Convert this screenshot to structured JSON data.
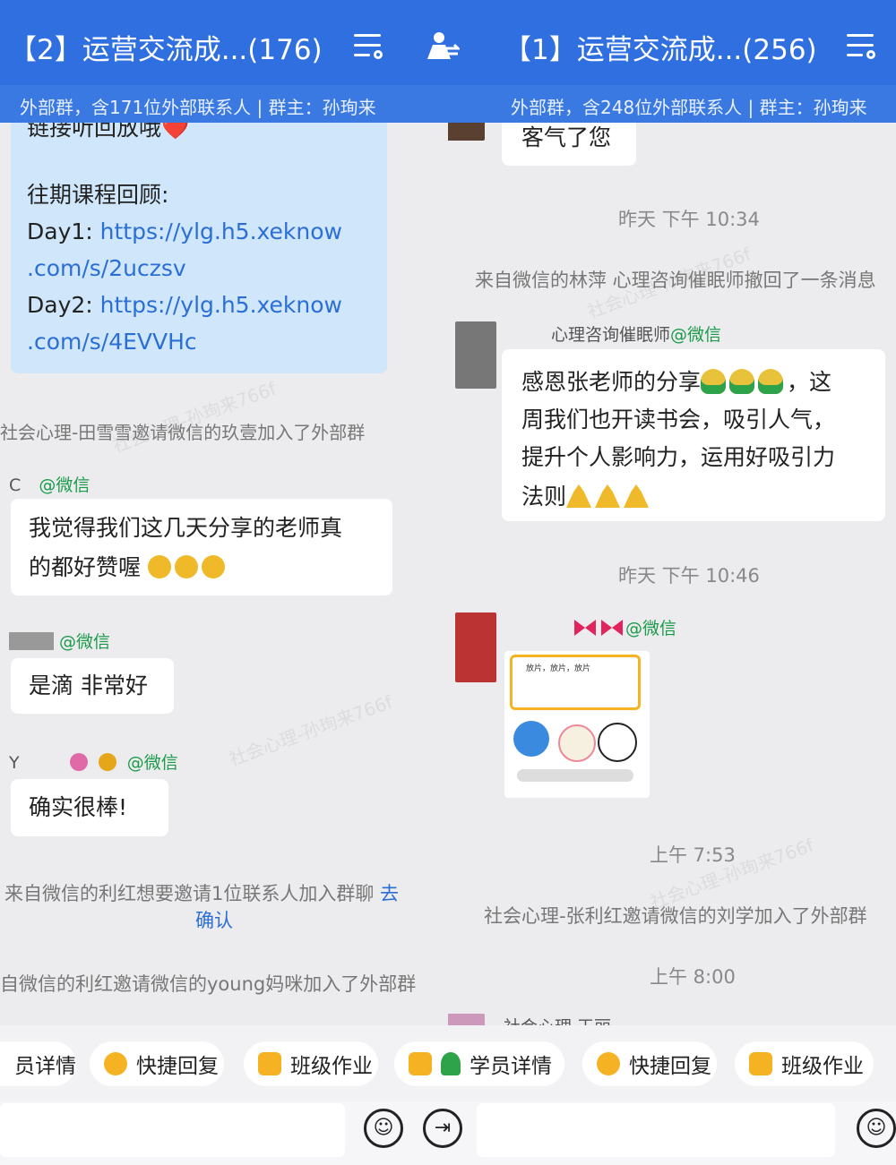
{
  "left": {
    "title": "【2】运营交流成...(176)",
    "subtitle": "外部群，含171位外部联系人 | 群主：孙珣来",
    "messages": {
      "link_bubble": {
        "line1": "链接听回放哦❤️",
        "review_label": "往期课程回顾:",
        "day1_label": "Day1:",
        "day1_url_a": "https://ylg.h5.xeknow",
        "day1_url_b": ".com/s/2uczsv",
        "day2_label": "Day2:",
        "day2_url_a": "https://ylg.h5.xeknow",
        "day2_url_b": ".com/s/4EVVHc"
      },
      "sys1": "社会心理-田雪雪邀请微信的玖壹加入了外部群",
      "sender1_prefix": "C",
      "sender1_tag": "@微信",
      "bubble1_a": "我觉得我们这几天分享的老师真",
      "bubble1_b": "的都好赞喔",
      "sender2_tag": "@微信",
      "bubble2": "是滴 非常好",
      "sender3_prefix": "Y",
      "sender3_tag": "@微信",
      "bubble3": "确实很棒!",
      "sys2_a": "来自微信的利红想要邀请1位联系人加入群聊",
      "sys2_link_a": "去",
      "sys2_link_b": "确认",
      "sys3": "自微信的利红邀请微信的young妈咪加入了外部群"
    }
  },
  "right": {
    "title": "【1】运营交流成...(256)",
    "subtitle": "外部群，含248位外部联系人 | 群主：孙珣来",
    "messages": {
      "bubble0": "客气了您",
      "time1": "昨天  下午 10:34",
      "sys1": "来自微信的林萍 心理咨询催眠师撤回了一条消息",
      "sender1_name": "心理咨询催眠师",
      "sender1_tag": "@微信",
      "bubble1_a": "感恩张老师的分享",
      "bubble1_b": "，这",
      "bubble1_c": "周我们也开读书会，吸引人气，",
      "bubble1_d": "提升个人影响力，运用好吸引力",
      "bubble1_e": "法则",
      "time2": "昨天  下午 10:46",
      "sender2_tag": "@微信",
      "sticker_text": "放片，放片，放片",
      "time3": "上午 7:53",
      "sys2": "社会心理-张利红邀请微信的刘学加入了外部群",
      "time4": "上午 8:00",
      "sender3_partial": "社会心理  王丽"
    }
  },
  "toolbar": {
    "items": [
      "员详情",
      "快捷回复",
      "班级作业",
      "学员详情",
      "快捷回复",
      "班级作业"
    ]
  },
  "icons": {
    "menu": "list-settings-icon",
    "transfer": "person-transfer-icon",
    "emoji": "smiley-face-icon",
    "voice": "voice-input-icon"
  },
  "watermark": "社会心理-孙珣来766f",
  "colors": {
    "header": "#2f6fe0",
    "subheader": "#3a78e2",
    "link": "#2b6fd6",
    "wechat_tag": "#1a9b4a",
    "my_bubble": "#cfe6fb"
  }
}
